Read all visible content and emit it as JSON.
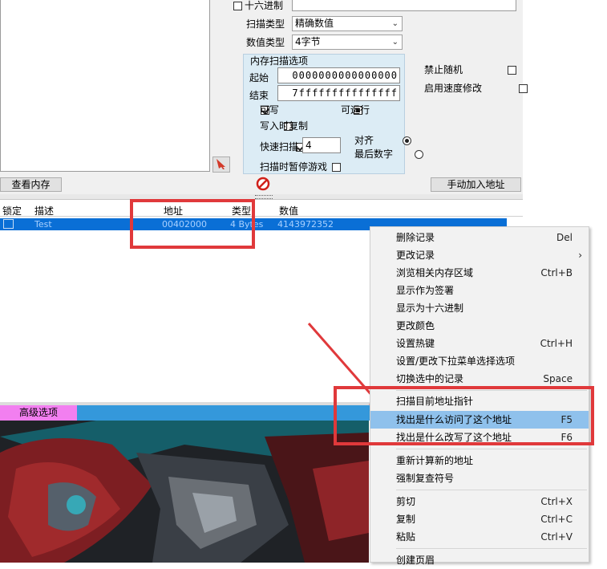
{
  "scan_panel": {
    "hex_label": "十六进制",
    "scan_type_label": "扫描类型",
    "scan_type_value": "精确数值",
    "value_type_label": "数值类型",
    "value_type_value": "4字节",
    "mem_options_title": "内存扫描选项",
    "start_label": "起始",
    "start_value": "0000000000000000",
    "stop_label": "结束",
    "stop_value": "7fffffffffffffff",
    "writable_label": "可写",
    "executable_label": "可运行",
    "copy_on_write_label": "写入时复制",
    "fast_scan_label": "快速扫描",
    "fast_scan_value": "4",
    "align_label": "对齐",
    "last_digit_label": "最后数字",
    "pause_game_label": "扫描时暂停游戏",
    "disable_random_label": "禁止随机",
    "speedhack_label": "启用速度修改"
  },
  "buttons": {
    "view_memory": "查看内存",
    "add_address_manually": "手动加入地址"
  },
  "table": {
    "headers": [
      "锁定",
      "描述",
      "地址",
      "类型",
      "数值"
    ],
    "rows": [
      {
        "description": "Test",
        "address": "00402000",
        "type": "4 Bytes",
        "value": "4143972352"
      }
    ]
  },
  "advanced_tab": "高级选项",
  "context_menu": {
    "items": [
      {
        "label": "删除记录",
        "shortcut": "Del"
      },
      {
        "label": "更改记录",
        "shortcut": "›"
      },
      {
        "label": "浏览相关内存区域",
        "shortcut": "Ctrl+B"
      },
      {
        "label": "显示作为签署",
        "shortcut": ""
      },
      {
        "label": "显示为十六进制",
        "shortcut": ""
      },
      {
        "label": "更改颜色",
        "shortcut": ""
      },
      {
        "label": "设置热键",
        "shortcut": "Ctrl+H"
      },
      {
        "label": "设置/更改下拉菜单选择选项",
        "shortcut": ""
      },
      {
        "label": "切换选中的记录",
        "shortcut": "Space"
      },
      {
        "label": "扫描目前地址指针",
        "shortcut": ""
      },
      {
        "label": "找出是什么访问了这个地址",
        "shortcut": "F5"
      },
      {
        "label": "找出是什么改写了这个地址",
        "shortcut": "F6"
      },
      {
        "label": "重新计算新的地址",
        "shortcut": ""
      },
      {
        "label": "强制复查符号",
        "shortcut": ""
      },
      {
        "label": "剪切",
        "shortcut": "Ctrl+X"
      },
      {
        "label": "复制",
        "shortcut": "Ctrl+C"
      },
      {
        "label": "粘贴",
        "shortcut": "Ctrl+V"
      },
      {
        "label": "创建页眉",
        "shortcut": ""
      }
    ]
  },
  "colors": {
    "highlight_box": "#e0393b",
    "selected_row": "#0a6fd6",
    "menu_highlight": "#8fc1ec",
    "advanced_tab": "#f27ff0",
    "advanced_bar": "#3498db"
  }
}
